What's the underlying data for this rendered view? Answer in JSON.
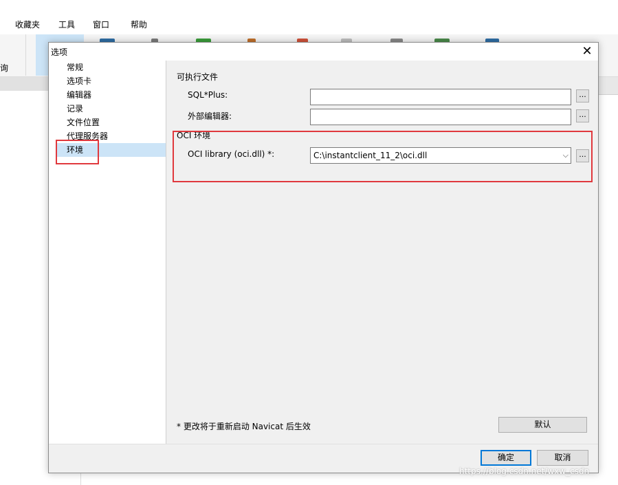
{
  "background": {
    "menu": [
      "收藏夹",
      "工具",
      "窗口",
      "帮助"
    ],
    "partial_label": "询"
  },
  "dialog": {
    "title": "选项",
    "nav_items": [
      "常规",
      "选项卡",
      "编辑器",
      "记录",
      "文件位置",
      "代理服务器",
      "环境"
    ],
    "selected_nav": "环境",
    "executables_section": "可执行文件",
    "sqlplus_label": "SQL*Plus:",
    "sqlplus_value": "",
    "external_editor_label": "外部编辑器:",
    "external_editor_value": "",
    "oci_section": "OCI 环境",
    "oci_library_label": "OCI library (oci.dll) *:",
    "oci_library_value": "C:\\instantclient_11_2\\oci.dll",
    "browse_label": "...",
    "note": "* 更改将于重新启动 Navicat 后生效",
    "default_button": "默认",
    "ok_button": "确定",
    "cancel_button": "取消"
  },
  "watermark": "https://blog.csdn.net/wxw_csdn",
  "colors": {
    "highlight": "#e0383d",
    "selection": "#cce4f7",
    "focus_border": "#0078d7"
  }
}
